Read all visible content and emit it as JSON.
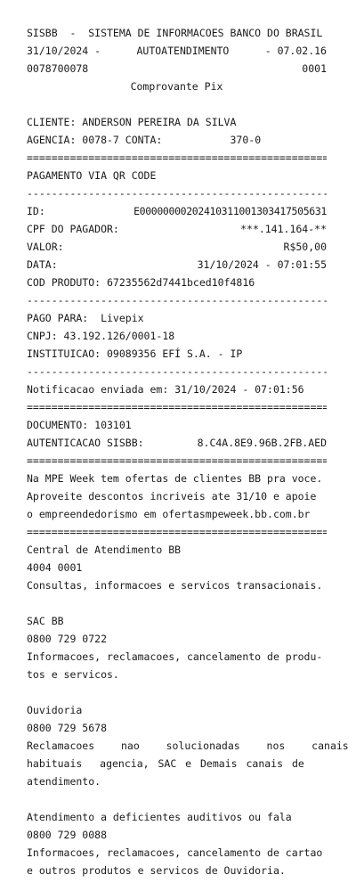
{
  "header": {
    "line1": "SISBB  -  SISTEMA DE INFORMACOES BANCO DO BRASIL",
    "date": "31/10/2024 -",
    "service": "AUTOATENDIMENTO",
    "code": "- 07.02.16",
    "terminal": "0078700078",
    "seq": "0001",
    "title": "Comprovante Pix"
  },
  "client": {
    "name_line": "CLIENTE: ANDERSON PEREIRA DA SILVA",
    "agency_label": "AGENCIA: 0078-7 CONTA:",
    "account": "370-0"
  },
  "separators": {
    "double": "=================================================",
    "single": "-------------------------------------------------"
  },
  "payment": {
    "type": "PAGAMENTO VIA QR CODE",
    "id_label": "ID:",
    "id_value": "E00000000202410311001303417505631",
    "cpf_label": "CPF DO PAGADOR:",
    "cpf_value": "***.141.164-**",
    "value_label": "VALOR:",
    "value": "R$50,00",
    "date_label": "DATA:",
    "date_value": "31/10/2024 - 07:01:55",
    "product": "COD PRODUTO: 67235562d7441bced10f4816"
  },
  "payee": {
    "paid_to": "PAGO PARA:  Livepix",
    "cnpj": "CNPJ: 43.192.126/0001-18",
    "institution": "INSTITUICAO: 09089356 EFÍ S.A. - IP"
  },
  "notification": "Notificacao enviada em: 31/10/2024 - 07:01:56",
  "document": {
    "number": "DOCUMENTO: 103101",
    "auth_label": "AUTENTICACAO SISBB:",
    "auth_value": "8.C4A.8E9.96B.2FB.AED"
  },
  "promo": {
    "line1": "Na MPE Week tem ofertas de clientes BB pra voce.",
    "line2": "Aproveite descontos incriveis ate 31/10 e apoie",
    "line3": "o empreendedorismo em ofertasmpeweek.bb.com.br"
  },
  "contacts": {
    "central_title": "Central de Atendimento BB",
    "central_phone": "4004 0001",
    "central_desc": "Consultas, informacoes e servicos transacionais.",
    "sac_title": "SAC BB",
    "sac_phone": "0800 729 0722",
    "sac_desc_1": "Informacoes, reclamacoes, cancelamento de produ-",
    "sac_desc_2": "tos e servicos.",
    "ouvidoria_title": "Ouvidoria",
    "ouvidoria_phone": "0800 729 5678",
    "ouvidoria_desc_1": "Reclamacoes  nao  solucionadas  nos  canais",
    "ouvidoria_desc_2": "habituais  agencia, SAC e Demais canais de",
    "ouvidoria_desc_3": "atendimento.",
    "deaf_title": "Atendimento a deficientes auditivos ou fala",
    "deaf_phone": "0800 729 0088",
    "deaf_desc_1": "Informacoes, reclamacoes, cancelamento de cartao",
    "deaf_desc_2": "e outros produtos e servicos de Ouvidoria."
  }
}
